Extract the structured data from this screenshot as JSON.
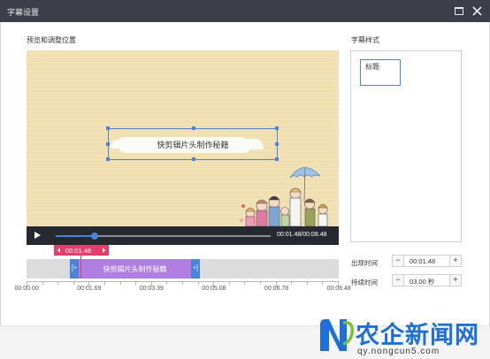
{
  "window": {
    "title": "字幕设置"
  },
  "sections": {
    "preview_label": "预览和调整位置",
    "styles_label": "字幕样式"
  },
  "preview": {
    "caption_text": "快剪辑片头制作秘籍"
  },
  "player": {
    "time_display": "00:01.48/00:08.48",
    "progress": 0.18
  },
  "timeline": {
    "marker_time": "00:01.48",
    "clip_label": "快剪辑片头制作秘籍",
    "clip_left_cap": "[+",
    "clip_right_cap": "+]",
    "ruler_labels": [
      "00:00.00",
      "00:01.69",
      "00:03.39",
      "00:05.08",
      "00:06.78",
      "00:08.48"
    ]
  },
  "styles": {
    "items": [
      {
        "label": "标题",
        "selected": true
      }
    ]
  },
  "properties": {
    "appear_label": "出现时间",
    "appear_value": "00:01.48",
    "duration_label": "持续时间",
    "duration_value": "03.00 秒",
    "minus": "−",
    "plus": "+"
  },
  "watermark": {
    "title": "农企新闻网",
    "url": "qy.nongcun5.com"
  },
  "colors": {
    "titlebar": "#3c3f4a",
    "accent": "#4a84d8",
    "marker": "#e93c6c",
    "clip": "#b07ee0"
  }
}
